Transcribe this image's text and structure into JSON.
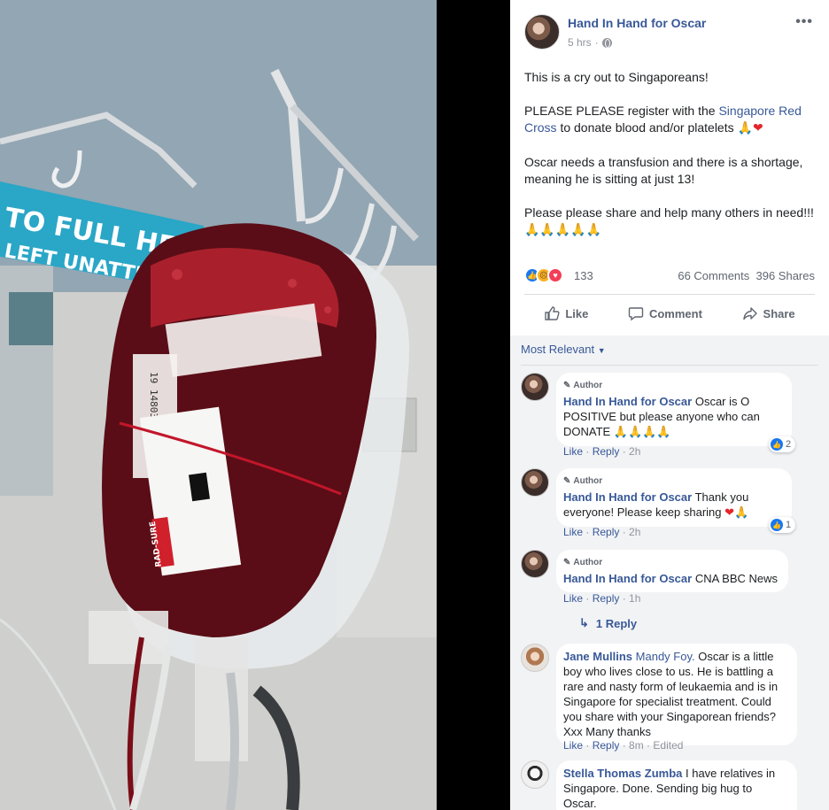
{
  "photo": {
    "sign_text_line1": "TO FULL HEIG",
    "sign_text_line2": "LEFT UNATTE",
    "bag_label_text": "RAD-SURE",
    "bag_side_code": "19 148036"
  },
  "post": {
    "page_name": "Hand In Hand for Oscar",
    "time": "5 hrs",
    "paragraph1": "This is a cry out to Singaporeans!",
    "paragraph2_pre": "PLEASE PLEASE register with the ",
    "paragraph2_link": "Singapore Red Cross",
    "paragraph2_post": " to donate blood and/or platelets ",
    "paragraph3": "Oscar needs a transfusion and there is a shortage, meaning he is sitting at just 13!",
    "paragraph4": "Please please share and help many others in need!!!",
    "reaction_count": "133",
    "comments_count": "66 Comments",
    "shares_count": "396 Shares"
  },
  "actions": {
    "like": "Like",
    "comment": "Comment",
    "share": "Share"
  },
  "comments_header": {
    "sort_label": "Most Relevant"
  },
  "comments": [
    {
      "author_tag": "Author",
      "name": "Hand In Hand for Oscar",
      "text": "Oscar is O POSITIVE but please anyone who can DONATE",
      "like": "Like",
      "reply": "Reply",
      "time": "2h",
      "reactions": "2"
    },
    {
      "author_tag": "Author",
      "name": "Hand In Hand for Oscar",
      "text": "Thank you everyone! Please keep sharing",
      "like": "Like",
      "reply": "Reply",
      "time": "2h",
      "reactions": "1"
    },
    {
      "author_tag": "Author",
      "name": "Hand In Hand for Oscar",
      "text": "CNA BBC News",
      "like": "Like",
      "reply": "Reply",
      "time": "1h",
      "replies_link": "1 Reply"
    },
    {
      "name": "Jane Mullins",
      "tag": "Mandy Foy.",
      "text": "Oscar is a little boy who lives close to us. He is battling a rare and nasty form of leukaemia and is in Singapore for specialist treatment. Could you share with your Singaporean friends? Xxx Many thanks",
      "like": "Like",
      "reply": "Reply",
      "time": "8m",
      "edited": "Edited"
    },
    {
      "name": "Stella Thomas Zumba",
      "text": "I have relatives in Singapore. Done. Sending big hug to Oscar."
    }
  ],
  "colors": {
    "link_blue": "#385898",
    "like_blue": "#1877f2",
    "heart_red": "#e3262b",
    "comments_bg": "#f2f3f5"
  }
}
